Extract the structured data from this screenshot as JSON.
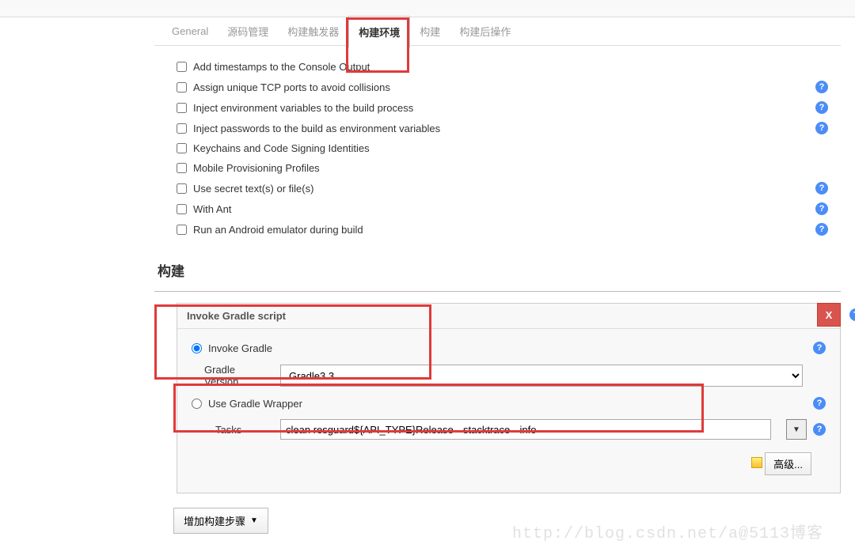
{
  "tabs": {
    "general": "General",
    "scm": "源码管理",
    "triggers": "构建触发器",
    "env": "构建环境",
    "build": "构建",
    "post": "构建后操作"
  },
  "options": {
    "timestamps": "Add timestamps to the Console Output",
    "tcp": "Assign unique TCP ports to avoid collisions",
    "injectEnv": "Inject environment variables to the build process",
    "injectPwd": "Inject passwords to the build as environment variables",
    "keychains": "Keychains and Code Signing Identities",
    "mobile": "Mobile Provisioning Profiles",
    "secret": "Use secret text(s) or file(s)",
    "withAnt": "With Ant",
    "android": "Run an Android emulator during build"
  },
  "section": {
    "build": "构建"
  },
  "gradle": {
    "title": "Invoke Gradle script",
    "invoke": "Invoke Gradle",
    "versionLabel": "Gradle Version",
    "versionValue": "Gradle3.3",
    "wrapper": "Use Gradle Wrapper",
    "tasksLabel": "Tasks",
    "tasksValue": "clean resguard${API_TYPE}Release --stacktrace --info",
    "advanced": "高级...",
    "close": "X"
  },
  "addStep": "增加构建步骤",
  "watermark": "http://blog.csdn.net/a@5113博客"
}
